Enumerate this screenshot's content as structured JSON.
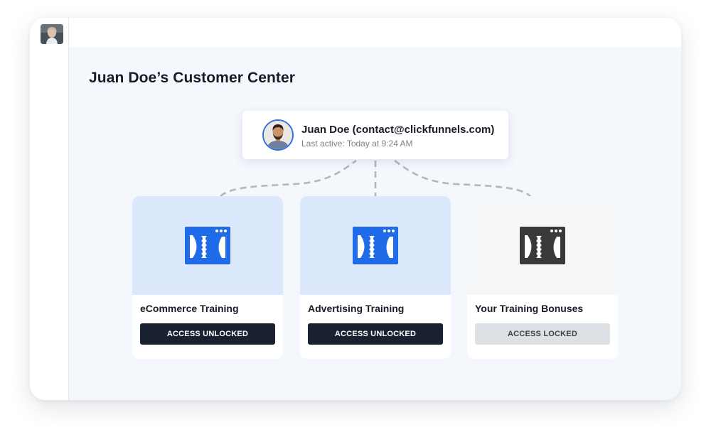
{
  "page": {
    "title": "Juan Doe’s Customer Center"
  },
  "sidebar": {
    "avatar_icon": "user-avatar-photo"
  },
  "user": {
    "name": "Juan Doe (contact@clickfunnels.com)",
    "last_active": "Last active: Today at 9:24 AM",
    "avatar_icon": "user-avatar-photo"
  },
  "courses": [
    {
      "title": "eCommerce Training",
      "button_label": "ACCESS UNLOCKED",
      "status": "unlocked",
      "logo_icon": "clickfunnels-logo-icon",
      "logo_color": "#1f6be8"
    },
    {
      "title": "Advertising Training",
      "button_label": "ACCESS UNLOCKED",
      "status": "unlocked",
      "logo_icon": "clickfunnels-logo-icon",
      "logo_color": "#1f6be8"
    },
    {
      "title": "Your Training Bonuses",
      "button_label": "ACCESS LOCKED",
      "status": "locked",
      "logo_icon": "clickfunnels-logo-icon",
      "logo_color": "#3a3a3a"
    }
  ],
  "colors": {
    "accent_blue": "#1f6be8",
    "unlocked_button": "#1a2232",
    "locked_button": "#dde0e5",
    "main_background": "#f4f8fd"
  }
}
